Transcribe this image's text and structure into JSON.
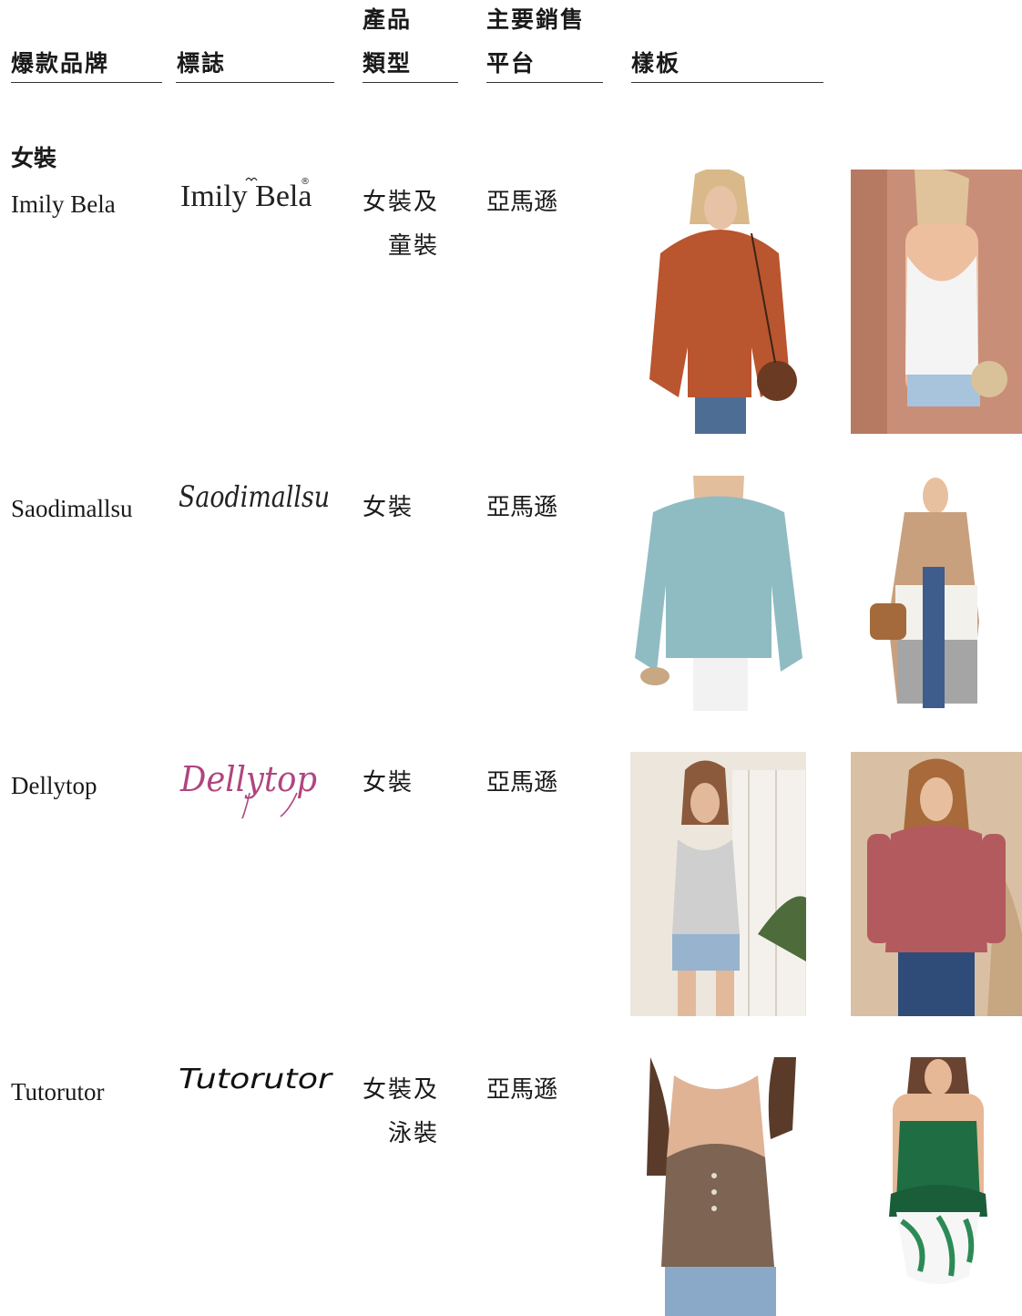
{
  "headers": {
    "brand": "爆款品牌",
    "logo": "標誌",
    "type_l1": "產品",
    "type_l2": "類型",
    "platform_l1": "主要銷售",
    "platform_l2": "平台",
    "sample": "樣板"
  },
  "section": "女裝",
  "rows": [
    {
      "brand": "Imily Bela",
      "logo_text": "Imily Bela",
      "type_l1": "女裝及",
      "type_l2": "童裝",
      "platform": "亞馬遜"
    },
    {
      "brand": "Saodimallsu",
      "logo_text": "Saodimallsu",
      "type_l1": "女裝",
      "type_l2": "",
      "platform": "亞馬遜"
    },
    {
      "brand": "Dellytop",
      "logo_text": "Dellytop",
      "type_l1": "女裝",
      "type_l2": "",
      "platform": "亞馬遜"
    },
    {
      "brand": "Tutorutor",
      "logo_text": "Tutorutor",
      "type_l1": "女裝及",
      "type_l2": "泳裝",
      "platform": "亞馬遜"
    }
  ],
  "colors": {
    "rust_sweater": "#b9552f",
    "white_tank": "#f4f4f4",
    "teal_sweater": "#8fbcc2",
    "cardigan_tan": "#c8a07e",
    "grey_knit_tank": "#cfcfcf",
    "rose_henley": "#b35a5e",
    "brown_tank": "#7d6453",
    "green_swim": "#1f6e43",
    "dellytop_pink": "#b0457e"
  }
}
